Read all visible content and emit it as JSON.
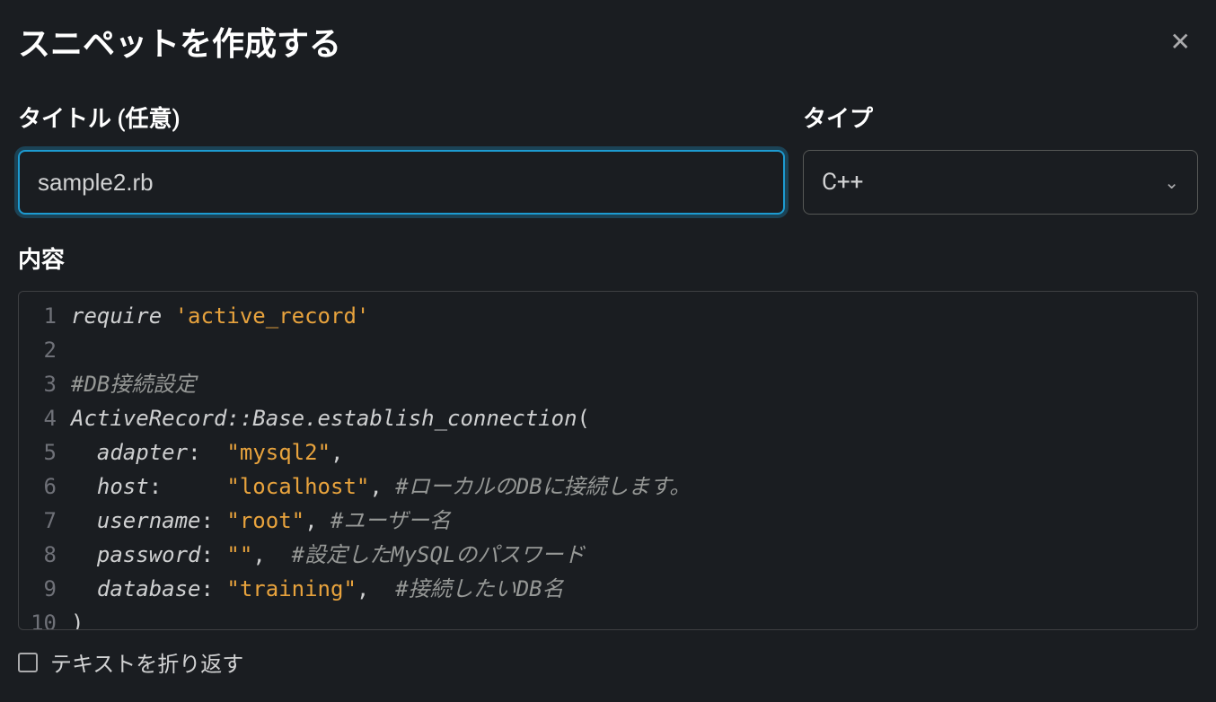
{
  "header": {
    "title": "スニペットを作成する"
  },
  "fields": {
    "title_label": "タイトル (任意)",
    "title_value": "sample2.rb",
    "type_label": "タイプ",
    "type_value": "C++",
    "content_label": "内容",
    "wrap_label": "テキストを折り返す"
  },
  "code": {
    "lines": [
      {
        "n": "1",
        "tokens": [
          [
            "kw",
            "require"
          ],
          [
            "plain",
            " "
          ],
          [
            "str",
            "'active_record'"
          ]
        ]
      },
      {
        "n": "2",
        "tokens": []
      },
      {
        "n": "3",
        "tokens": [
          [
            "com",
            "#DB接続設定"
          ]
        ]
      },
      {
        "n": "4",
        "tokens": [
          [
            "ident",
            "ActiveRecord::Base.establish_connection"
          ],
          [
            "plain",
            "("
          ]
        ]
      },
      {
        "n": "5",
        "tokens": [
          [
            "plain",
            "  "
          ],
          [
            "ident",
            "adapter"
          ],
          [
            "plain",
            ":  "
          ],
          [
            "str",
            "\"mysql2\""
          ],
          [
            "plain",
            ","
          ]
        ]
      },
      {
        "n": "6",
        "tokens": [
          [
            "plain",
            "  "
          ],
          [
            "ident",
            "host"
          ],
          [
            "plain",
            ":     "
          ],
          [
            "str",
            "\"localhost\""
          ],
          [
            "plain",
            ", "
          ],
          [
            "com",
            "#ローカルのDBに接続します。"
          ]
        ]
      },
      {
        "n": "7",
        "tokens": [
          [
            "plain",
            "  "
          ],
          [
            "ident",
            "username"
          ],
          [
            "plain",
            ": "
          ],
          [
            "str",
            "\"root\""
          ],
          [
            "plain",
            ", "
          ],
          [
            "com",
            "#ユーザー名"
          ]
        ]
      },
      {
        "n": "8",
        "tokens": [
          [
            "plain",
            "  "
          ],
          [
            "ident",
            "password"
          ],
          [
            "plain",
            ": "
          ],
          [
            "str",
            "\"\""
          ],
          [
            "plain",
            ",  "
          ],
          [
            "com",
            "#設定したMySQLのパスワード"
          ]
        ]
      },
      {
        "n": "9",
        "tokens": [
          [
            "plain",
            "  "
          ],
          [
            "ident",
            "database"
          ],
          [
            "plain",
            ": "
          ],
          [
            "str",
            "\"training\""
          ],
          [
            "plain",
            ",  "
          ],
          [
            "com",
            "#接続したいDB名"
          ]
        ]
      },
      {
        "n": "10",
        "tokens": [
          [
            "plain",
            ")"
          ]
        ]
      }
    ]
  }
}
